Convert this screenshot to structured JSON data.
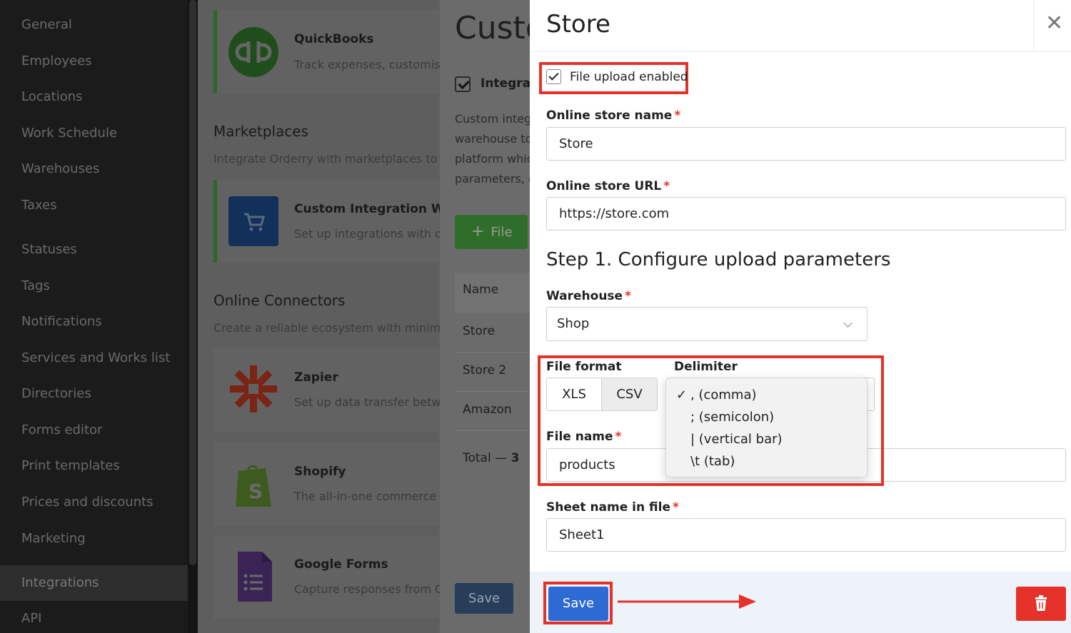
{
  "sidebar": {
    "items": [
      {
        "label": "General"
      },
      {
        "label": "Employees"
      },
      {
        "label": "Locations"
      },
      {
        "label": "Work Schedule"
      },
      {
        "label": "Warehouses"
      },
      {
        "label": "Taxes"
      },
      {
        "label": "Statuses"
      },
      {
        "label": "Tags"
      },
      {
        "label": "Notifications"
      },
      {
        "label": "Services and Works list"
      },
      {
        "label": "Directories"
      },
      {
        "label": "Forms editor"
      },
      {
        "label": "Print templates"
      },
      {
        "label": "Prices and discounts"
      },
      {
        "label": "Marketing"
      },
      {
        "label": "Integrations"
      },
      {
        "label": "API"
      }
    ],
    "active": "Integrations"
  },
  "integrations": {
    "quickbooks": {
      "title": "QuickBooks",
      "sub": "Track expenses, customise"
    },
    "marketplaces": {
      "title": "Marketplaces",
      "sub": "Integrate Orderry with marketplaces to i"
    },
    "custom": {
      "title": "Custom Integration With",
      "sub": "Set up integrations with o"
    },
    "online_connectors": {
      "title": "Online Connectors",
      "sub": "Create a reliable ecosystem with minimu"
    },
    "zapier": {
      "title": "Zapier",
      "sub": "Set up data transfer betw"
    },
    "shopify": {
      "title": "Shopify",
      "sub": "The all-in-one commerce p"
    },
    "google_forms": {
      "title": "Google Forms",
      "sub": "Capture responses from G"
    }
  },
  "custom_panel": {
    "title": "Custo",
    "checkbox_label": "Integrat",
    "desc": [
      "Custom integ",
      "warehouse to",
      "platform whic",
      "parameters, g"
    ],
    "file_button": "File",
    "table_header": "Name",
    "rows": [
      "Store",
      "Store 2",
      "Amazon"
    ],
    "total_label": "Total —",
    "total_count": "3",
    "save_label": "Save"
  },
  "store": {
    "title": "Store",
    "file_upload_label": "File upload enabled",
    "file_upload_checked": true,
    "online_store_name_label": "Online store name",
    "online_store_name_value": "Store",
    "online_store_url_label": "Online store URL",
    "online_store_url_value": "https://store.com",
    "step_title": "Step 1. Configure upload parameters",
    "warehouse_label": "Warehouse",
    "warehouse_value": "Shop",
    "file_format_label": "File format",
    "file_formats": [
      "XLS",
      "CSV"
    ],
    "file_format_selected": "CSV",
    "delimiter_label": "Delimiter",
    "delimiter_options": [
      ", (comma)",
      "; (semicolon)",
      "| (vertical bar)",
      "\\t (tab)"
    ],
    "delimiter_selected": ", (comma)",
    "file_name_label": "File name",
    "file_name_value": "products",
    "sheet_name_label": "Sheet name in file",
    "sheet_name_value": "Sheet1",
    "required_mark": "*",
    "save_label": "Save"
  },
  "colors": {
    "accent_blue": "#2d6ad3",
    "danger_red": "#e4322b",
    "highlight_red": "#e4322b"
  }
}
